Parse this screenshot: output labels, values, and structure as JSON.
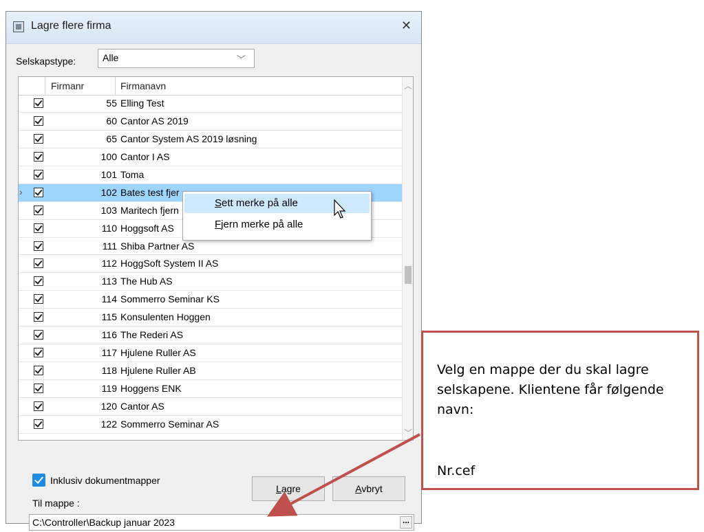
{
  "window": {
    "title": "Lagre flere firma",
    "close_glyph": "✕"
  },
  "filter": {
    "label": "Selskapstype:",
    "value": "Alle"
  },
  "grid": {
    "col_number": "Firmanr",
    "col_name": "Firmanavn",
    "rows": [
      {
        "num": "55",
        "name": "Elling Test",
        "checked": true
      },
      {
        "num": "60",
        "name": "Cantor AS 2019",
        "checked": true
      },
      {
        "num": "65",
        "name": "Cantor System AS 2019 løsning",
        "checked": true
      },
      {
        "num": "100",
        "name": "Cantor I AS",
        "checked": true
      },
      {
        "num": "101",
        "name": "Toma",
        "checked": true
      },
      {
        "num": "102",
        "name": "Bates test fjer",
        "checked": true,
        "selected": true
      },
      {
        "num": "103",
        "name": "Maritech fjern",
        "checked": true
      },
      {
        "num": "110",
        "name": "Hoggsoft AS",
        "checked": true
      },
      {
        "num": "111",
        "name": "Shiba Partner AS",
        "checked": true
      },
      {
        "num": "112",
        "name": "HoggSoft System II AS",
        "checked": true
      },
      {
        "num": "113",
        "name": "The Hub AS",
        "checked": true
      },
      {
        "num": "114",
        "name": "Sommerro Seminar KS",
        "checked": true
      },
      {
        "num": "115",
        "name": "Konsulenten Hoggen",
        "checked": true
      },
      {
        "num": "116",
        "name": "The Rederi AS",
        "checked": true
      },
      {
        "num": "117",
        "name": "Hjulene Ruller AS",
        "checked": true
      },
      {
        "num": "118",
        "name": "Hjulene Ruller AB",
        "checked": true
      },
      {
        "num": "119",
        "name": "Hoggens ENK",
        "checked": true
      },
      {
        "num": "120",
        "name": "Cantor AS",
        "checked": true
      },
      {
        "num": "122",
        "name": "Sommerro Seminar AS",
        "checked": true
      }
    ]
  },
  "context_menu": {
    "items": [
      {
        "label_first": "S",
        "label_rest": "ett merke på alle"
      },
      {
        "label_first": "F",
        "label_rest": "jern merke på alle"
      }
    ]
  },
  "footer": {
    "include_docs_label": "Inklusiv dokumentmapper",
    "include_docs_checked": true,
    "folder_label": "Til mappe :",
    "folder_value": "C:\\Controller\\Backup januar 2023",
    "browse_label": "...",
    "save_first": "L",
    "save_rest": "agre",
    "cancel_first": "A",
    "cancel_rest": "vbryt"
  },
  "callout": {
    "text": "Velg en mappe der du skal lagre selskapene. Klientene får følgende navn:",
    "sub": "Nr.cef",
    "border_color": "#c0504d"
  }
}
